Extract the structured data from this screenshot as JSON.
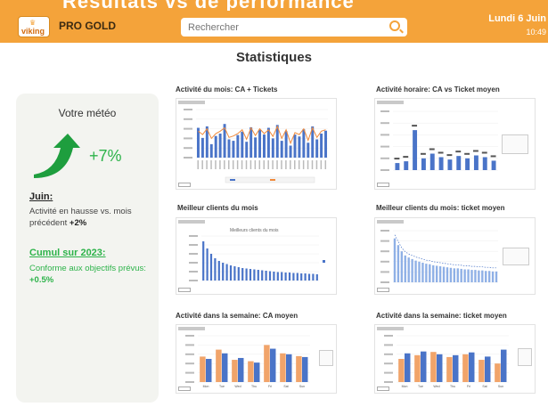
{
  "header": {
    "banner_text": "Résultats vs de performance",
    "brand_logo": "viking",
    "brand": "PRO GOLD",
    "search_placeholder": "Rechercher",
    "date": "Lundi 6 Juin",
    "time": "10:49"
  },
  "page_title": "Statistiques",
  "weather": {
    "title": "Votre météo",
    "change": "+7%",
    "month_heading": "Juin:",
    "month_text": "Activité en hausse vs. mois précédent",
    "month_value": "+2%",
    "cumul_heading": "Cumul sur 2023:",
    "cumul_text": "Conforme aux objectifs prévus:",
    "cumul_value": "+0.5%"
  },
  "charts": {
    "c1_title": "Activité du mois: CA + Tickets",
    "c2_title": "Activité horaire: CA vs Ticket moyen",
    "c3_title": "Meilleur clients du mois",
    "c3_inner_title": "Meilleurs clients du mois",
    "c4_title": "Meilleur clients du mois: ticket moyen",
    "c5_title": "Activité dans la semaine: CA moyen",
    "c6_title": "Activité dans la semaine: ticket moyen"
  },
  "colors": {
    "accent": "#f4a33a",
    "green": "#2db34a",
    "bar_blue": "#4a74c8",
    "bar_orange": "#f1a46a"
  },
  "chart_data": [
    {
      "type": "bar",
      "name": "c1",
      "bars": [
        62,
        41,
        65,
        28,
        45,
        50,
        70,
        38,
        35,
        47,
        54,
        33,
        63,
        42,
        58,
        48,
        62,
        40,
        68,
        35,
        55,
        25,
        48,
        44,
        59,
        31,
        65,
        38,
        50,
        56
      ],
      "line": [
        55,
        48,
        60,
        40,
        50,
        55,
        62,
        42,
        45,
        50,
        58,
        38,
        62,
        46,
        60,
        50,
        58,
        44,
        65,
        40,
        58,
        30,
        52,
        48,
        60,
        36,
        62,
        42,
        55,
        58
      ]
    },
    {
      "type": "bar",
      "name": "c2",
      "values": [
        12,
        15,
        68,
        20,
        28,
        22,
        18,
        24,
        20,
        25,
        22,
        16
      ]
    },
    {
      "type": "bar",
      "name": "c3",
      "values": [
        88,
        72,
        60,
        50,
        44,
        40,
        37,
        34,
        32,
        30,
        28,
        27,
        26,
        25,
        24,
        23,
        22,
        21,
        20,
        19,
        19,
        18,
        18,
        17,
        17,
        16,
        16,
        15,
        15,
        14
      ]
    },
    {
      "type": "bar",
      "name": "c4",
      "values": [
        85,
        72,
        60,
        52,
        48,
        45,
        42,
        40,
        38,
        36,
        35,
        33,
        32,
        31,
        30,
        29,
        28,
        27,
        27,
        26,
        25,
        25,
        24,
        24,
        23,
        23,
        22,
        22,
        21,
        21
      ]
    },
    {
      "type": "bar",
      "name": "c5",
      "categories": [
        "Mon",
        "Tue",
        "Wed",
        "Thu",
        "Fri",
        "Sat",
        "Sun"
      ],
      "series": [
        {
          "values": [
            55,
            70,
            48,
            45,
            80,
            62,
            56
          ]
        },
        {
          "values": [
            50,
            62,
            52,
            42,
            72,
            60,
            54
          ]
        }
      ]
    },
    {
      "type": "bar",
      "name": "c6",
      "categories": [
        "Mon",
        "Tue",
        "Wed",
        "Thu",
        "Fri",
        "Sat",
        "Sun"
      ],
      "series": [
        {
          "values": [
            50,
            58,
            65,
            54,
            60,
            48,
            40
          ]
        },
        {
          "values": [
            62,
            66,
            60,
            58,
            64,
            55,
            70
          ]
        }
      ]
    }
  ]
}
